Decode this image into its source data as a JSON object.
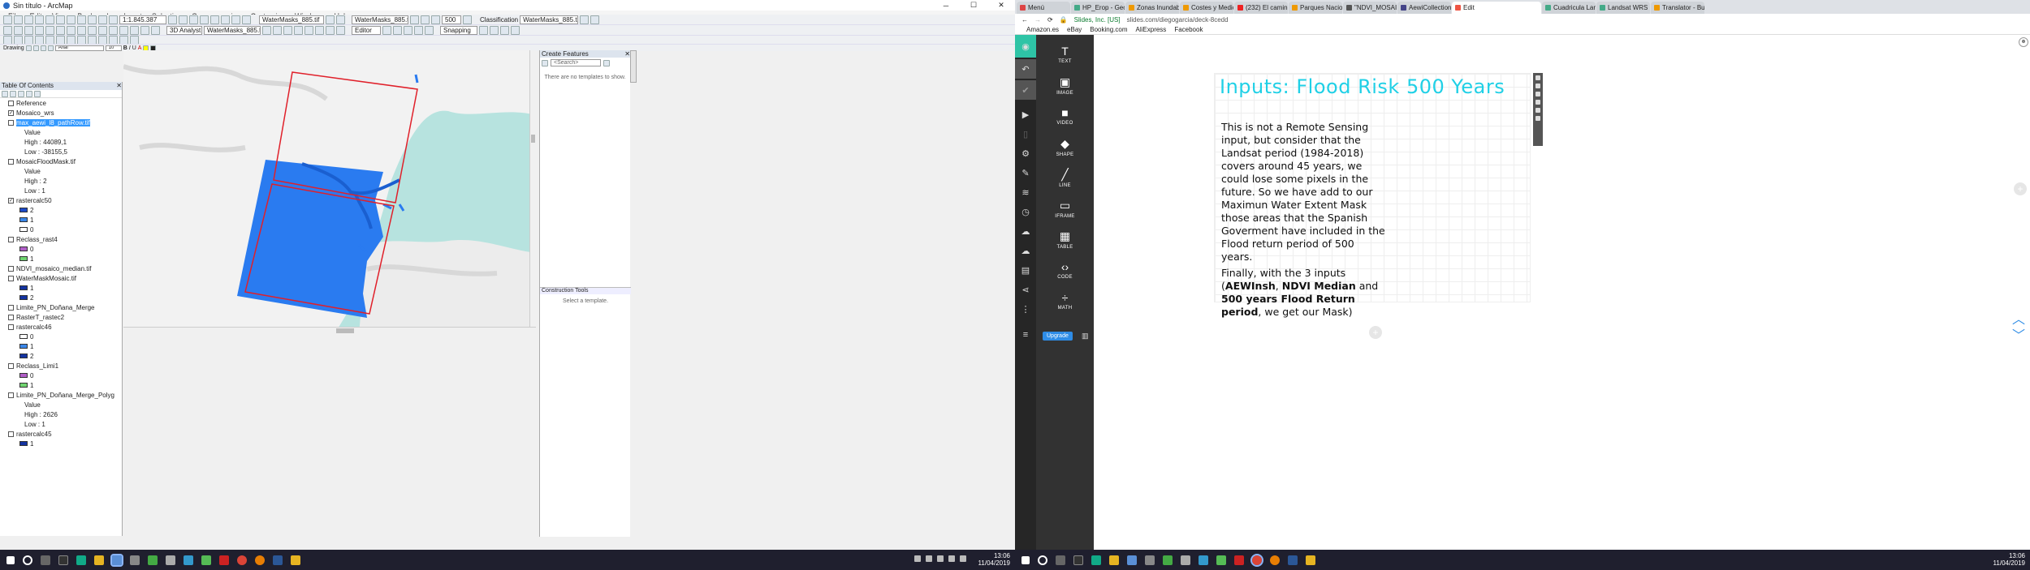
{
  "arcmap": {
    "title": "Sin título - ArcMap",
    "menu": [
      "File",
      "Edit",
      "View",
      "Bookmarks",
      "Insert",
      "Selection",
      "Geoprocessing",
      "Customize",
      "Windows",
      "Help"
    ],
    "scale": "1:1.845.387",
    "layer_select_1": "WaterMasks_885.tif",
    "layer_select_2": "WaterMasks_885.tif",
    "classification_label": "Classification",
    "classification_layer": "WaterMasks_885.tif",
    "zoom_value": "500",
    "analyst_label": "3D Analyst",
    "analyst_layer": "WaterMasks_885.tif",
    "editor_label": "Editor",
    "snapping_label": "Snapping",
    "drawing_label": "Drawing",
    "font_name": "Arial",
    "font_size": "10",
    "toc_title": "Table Of Contents",
    "toc": [
      {
        "name": "Reference",
        "check": false
      },
      {
        "name": "Mosaico_wrs",
        "check": true
      },
      {
        "name": "max_aewi_l8_pathRow.tif",
        "check": false,
        "selected": true
      },
      {
        "sub": "Value"
      },
      {
        "sub": "High : 44089,1"
      },
      {
        "sub": "Low : -38155,5"
      },
      {
        "name": "MosaicFloodMask.tif",
        "check": false
      },
      {
        "sub": "Value"
      },
      {
        "sub": "High : 2"
      },
      {
        "sub": "Low : 1"
      },
      {
        "name": "rastercalc50",
        "check": true
      },
      {
        "cls": "2",
        "color": "#1a49c8"
      },
      {
        "cls": "1",
        "color": "#3a86e8"
      },
      {
        "cls": "0",
        "color": "#ffffff"
      },
      {
        "name": "Reclass_rast4",
        "check": false
      },
      {
        "cls": "0",
        "color": "#b05ec7"
      },
      {
        "cls": "1",
        "color": "#6fd46f"
      },
      {
        "name": "NDVI_mosaico_median.tif",
        "check": false
      },
      {
        "name": "WaterMaskMosaic.tif",
        "check": false
      },
      {
        "cls": "1",
        "color": "#1433a0"
      },
      {
        "cls": "2",
        "color": "#1433a0"
      },
      {
        "name": "Limite_PN_Doñana_Merge",
        "check": false
      },
      {
        "name": "RasterT_rastec2",
        "check": false
      },
      {
        "name": "rastercalc46",
        "check": false
      },
      {
        "cls": "0",
        "color": "#ffffff"
      },
      {
        "cls": "1",
        "color": "#3a86e8"
      },
      {
        "cls": "2",
        "color": "#1433a0"
      },
      {
        "name": "Reclass_Limi1",
        "check": false
      },
      {
        "cls": "0",
        "color": "#b05ec7"
      },
      {
        "cls": "1",
        "color": "#6fd46f"
      },
      {
        "name": "Limite_PN_Doñana_Merge_Polyg",
        "check": false
      },
      {
        "sub": "Value"
      },
      {
        "sub": "High : 2626"
      },
      {
        "sub": "Low : 1"
      },
      {
        "name": "rastercalc45",
        "check": false
      },
      {
        "cls": "1",
        "color": "#1433a0"
      }
    ],
    "create_features_title": "Create Features",
    "cf_search": "<Search>",
    "cf_empty": "There are no templates to show.",
    "construction_tools_title": "Construction Tools",
    "select_template": "Select a template.",
    "clock_time": "13:06",
    "clock_date": "11/04/2019"
  },
  "browser": {
    "tabs": [
      {
        "label": "Menú",
        "color": "#d44"
      },
      {
        "label": "HP_Erop - Geog",
        "color": "#4a8"
      },
      {
        "label": "Zonas Inundable",
        "color": "#e90"
      },
      {
        "label": "Costes y Medio",
        "color": "#e90"
      },
      {
        "label": "(232) El camino c",
        "color": "#e22"
      },
      {
        "label": "Parques Naciona",
        "color": "#e90"
      },
      {
        "label": "\"NDVI_MOSAIC",
        "color": "#555"
      },
      {
        "label": "AewiCollection",
        "color": "#448"
      },
      {
        "label": "Edit",
        "color": "#e54",
        "active": true
      },
      {
        "label": "Cuadricula Lands",
        "color": "#4a8"
      },
      {
        "label": "Landsat WRS 2 b",
        "color": "#4a8"
      },
      {
        "label": "Translator - Busc",
        "color": "#e90"
      }
    ],
    "site_label": "Slides, Inc. [US]",
    "url": "slides.com/diegogarcia/deck-8cedd",
    "bookmarks": [
      "Amazon.es",
      "eBay",
      "Booking.com",
      "AliExpress",
      "Facebook"
    ],
    "tools": [
      {
        "label": "TEXT",
        "glyph": "T"
      },
      {
        "label": "IMAGE",
        "glyph": "▣"
      },
      {
        "label": "VIDEO",
        "glyph": "■"
      },
      {
        "label": "SHAPE",
        "glyph": "◆"
      },
      {
        "label": "LINE",
        "glyph": "╱"
      },
      {
        "label": "IFRAME",
        "glyph": "▭"
      },
      {
        "label": "TABLE",
        "glyph": "▦"
      },
      {
        "label": "CODE",
        "glyph": "‹›"
      },
      {
        "label": "MATH",
        "glyph": "÷"
      }
    ],
    "upgrade_label": "Upgrade",
    "slide_title": "Inputs: Flood Risk 500 Years",
    "slide_p1": "This is not a Remote Sensing input, but consider that the Landsat period (1984-2018) covers around 45 years, we could lose some pixels in the future. So we have add to our Maximun Water Extent Mask those areas that the Spanish Goverment have included in the  Flood return period of 500 years.",
    "slide_p2_a": "Finally, with the 3 inputs (",
    "slide_p2_b1": "AEWInsh",
    "slide_p2_c": ", ",
    "slide_p2_b2": "NDVI Median",
    "slide_p2_d": " and ",
    "slide_p2_b3": "500 years Flood Return period",
    "slide_p2_e": ", we get our Mask)",
    "clock_time": "13:06",
    "clock_date": "11/04/2019"
  }
}
